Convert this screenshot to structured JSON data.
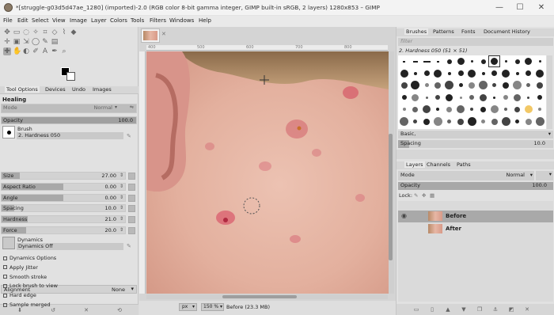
{
  "window": {
    "title": "*[struggle-g03d5d47ae_1280] (imported)-2.0 (RGB color 8-bit gamma integer, GIMP built-in sRGB, 2 layers) 1280x853 – GIMP",
    "controls": [
      "—",
      "☐",
      "✕"
    ]
  },
  "menu": [
    "File",
    "Edit",
    "Select",
    "View",
    "Image",
    "Layer",
    "Colors",
    "Tools",
    "Filters",
    "Windows",
    "Help"
  ],
  "left_dock": {
    "tabs": [
      "Tool Options",
      "Devices",
      "Undo",
      "Images"
    ],
    "tool_title": "Healing",
    "mode_label": "Mode",
    "mode_value": "Normal",
    "opacity_label": "Opacity",
    "opacity_value": "100.0",
    "brush_label": "Brush",
    "brush_value": "2. Hardness 050",
    "sliders": [
      {
        "label": "Size",
        "value": "27.00",
        "fill": 0.15
      },
      {
        "label": "Aspect Ratio",
        "value": "0.00",
        "fill": 0.5
      },
      {
        "label": "Angle",
        "value": "0.00",
        "fill": 0.5
      },
      {
        "label": "Spacing",
        "value": "10.0",
        "fill": 0.1
      },
      {
        "label": "Hardness",
        "value": "21.0",
        "fill": 0.21
      },
      {
        "label": "Force",
        "value": "20.0",
        "fill": 0.2
      }
    ],
    "dynamics_label": "Dynamics",
    "dynamics_value": "Dynamics Off",
    "options": [
      {
        "label": "Dynamics Options",
        "checked": false
      },
      {
        "label": "Apply Jitter",
        "checked": false
      },
      {
        "label": "Smooth stroke",
        "checked": false
      },
      {
        "label": "Lock brush to view",
        "checked": false
      },
      {
        "label": "Hard edge",
        "checked": false
      },
      {
        "label": "Sample merged",
        "checked": false
      }
    ],
    "alignment_label": "Alignment",
    "alignment_value": "None"
  },
  "canvas": {
    "image_tab": "struggle thumbnail",
    "unit": "px",
    "zoom": "150 %",
    "status": "Before (23.3 MB)",
    "ruler_ticks": [
      "400",
      "500",
      "600",
      "700",
      "800"
    ],
    "vruler_ticks": [
      "100",
      "200",
      "300",
      "400",
      "500",
      "600"
    ]
  },
  "right_dock": {
    "top_tabs": [
      "Brushes",
      "Patterns",
      "Fonts",
      "Document History"
    ],
    "filter_placeholder": "filter",
    "brush_name": "2. Hardness 050 (51 × 51)",
    "tag_value": "Basic,",
    "spacing_label": "Spacing",
    "spacing_value": "10.0",
    "layer_tabs": [
      "Layers",
      "Channels",
      "Paths"
    ],
    "mode_label": "Mode",
    "mode_value": "Normal",
    "opacity_label": "Opacity",
    "opacity_value": "100.0",
    "lock_label": "Lock:",
    "layers": [
      {
        "name": "Before",
        "selected": true,
        "visible": true
      },
      {
        "name": "After",
        "selected": false,
        "visible": false
      }
    ]
  }
}
